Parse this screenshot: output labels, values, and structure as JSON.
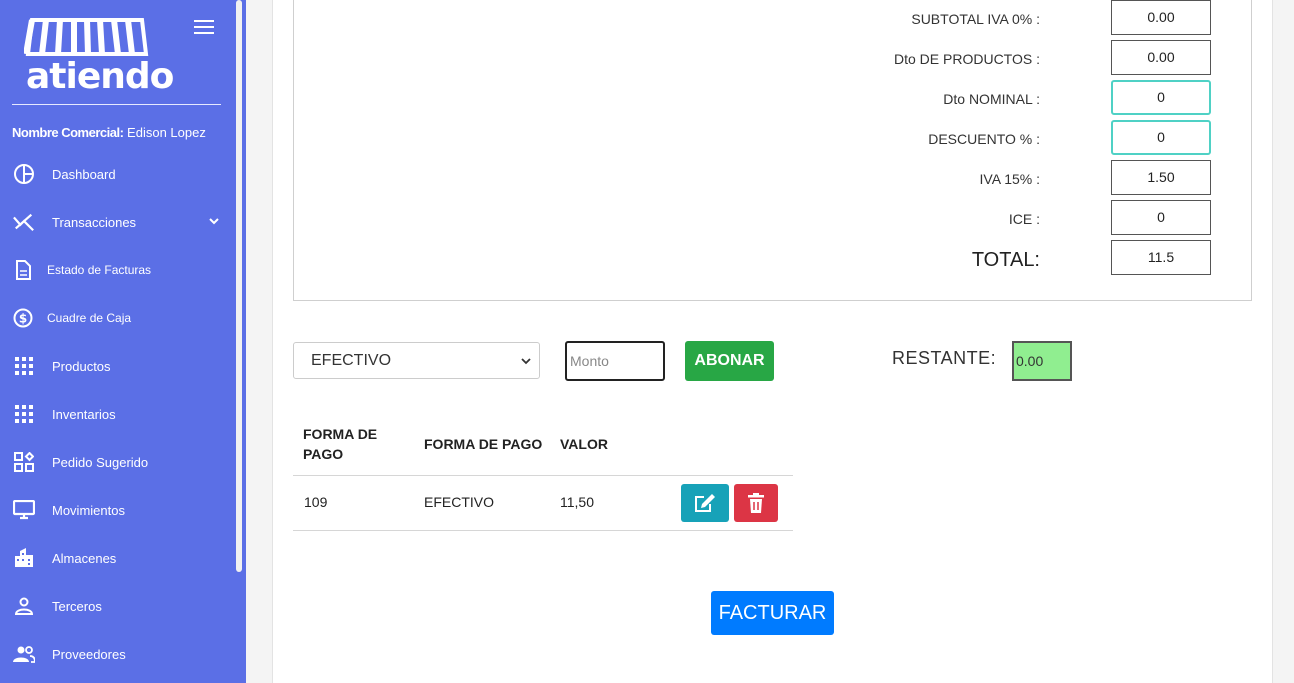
{
  "brand": {
    "logo_text": "atiendo"
  },
  "sidebar": {
    "commercial_label": "Nombre Comercial:",
    "commercial_value": "Edison Lopez",
    "items": [
      {
        "label": "Dashboard",
        "icon": "dashboard-icon"
      },
      {
        "label": "Transacciones",
        "icon": "transactions-icon"
      },
      {
        "label": "Estado de Facturas",
        "icon": "document-icon"
      },
      {
        "label": "Cuadre de Caja",
        "icon": "dollar-circle-icon"
      },
      {
        "label": "Productos",
        "icon": "grid-icon"
      },
      {
        "label": "Inventarios",
        "icon": "grid-icon"
      },
      {
        "label": "Pedido Sugerido",
        "icon": "widgets-icon"
      },
      {
        "label": "Movimientos",
        "icon": "monitor-icon"
      },
      {
        "label": "Almacenes",
        "icon": "building-icon"
      },
      {
        "label": "Terceros",
        "icon": "person-icon"
      },
      {
        "label": "Proveedores",
        "icon": "people-icon"
      }
    ]
  },
  "totals": {
    "subtotal_iva0": {
      "label": "SUBTOTAL IVA 0% :",
      "value": "0.00"
    },
    "dto_productos": {
      "label": "Dto DE PRODUCTOS :",
      "value": "0.00"
    },
    "dto_nominal": {
      "label": "Dto NOMINAL :",
      "value": "0"
    },
    "descuento": {
      "label": "DESCUENTO % :",
      "value": "0"
    },
    "iva15": {
      "label": "IVA 15% :",
      "value": "1.50"
    },
    "ice": {
      "label": "ICE :",
      "value": "0"
    },
    "total": {
      "label": "TOTAL:",
      "value": "11.5"
    }
  },
  "payment": {
    "method_selected": "EFECTIVO",
    "amount_placeholder": "Monto",
    "abonar_label": "ABONAR",
    "restante_label": "RESTANTE:",
    "restante_value": "0.00"
  },
  "payments_table": {
    "headers": [
      "FORMA DE PAGO",
      "FORMA DE PAGO",
      "VALOR"
    ],
    "rows": [
      {
        "code": "109",
        "method": "EFECTIVO",
        "value": "11,50"
      }
    ]
  },
  "facturar_label": "FACTURAR",
  "colors": {
    "sidebar": "#5b6fe6",
    "abonar": "#28a745",
    "facturar": "#007bff",
    "edit": "#17a2b8",
    "delete": "#dc3545",
    "restante_bg": "#90ee90"
  }
}
